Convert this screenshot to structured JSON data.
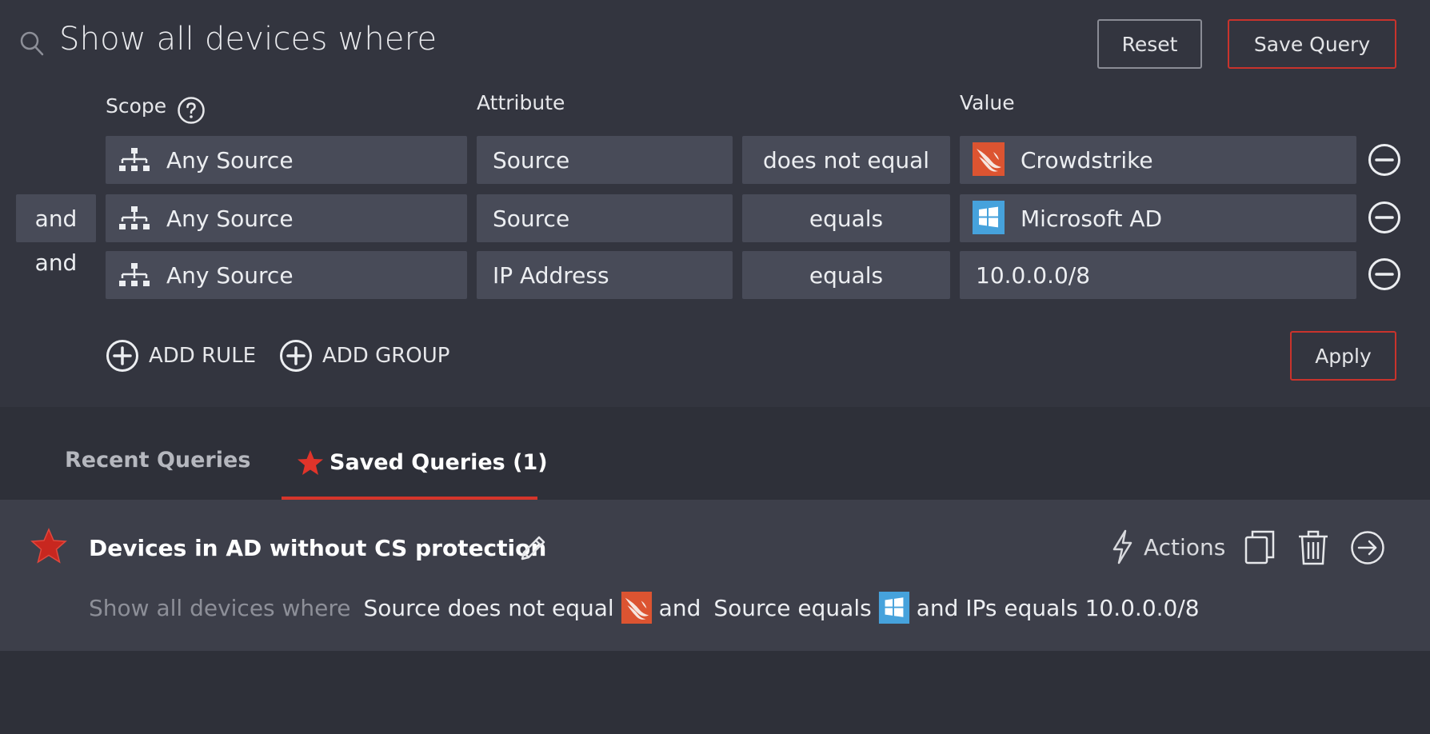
{
  "query": {
    "headline": "Show all devices where",
    "reset_label": "Reset",
    "save_label": "Save Query",
    "apply_label": "Apply",
    "columns": {
      "scope": "Scope",
      "attribute": "Attribute",
      "value": "Value"
    },
    "rules": [
      {
        "conjunction": "",
        "scope": "Any Source",
        "attribute": "Source",
        "operator": "does not equal",
        "value": "Crowdstrike",
        "value_icon": "crowdstrike-logo"
      },
      {
        "conjunction": "and",
        "scope": "Any Source",
        "attribute": "Source",
        "operator": "equals",
        "value": "Microsoft AD",
        "value_icon": "windows-logo"
      },
      {
        "conjunction": "and",
        "scope": "Any Source",
        "attribute": "IP Address",
        "operator": "equals",
        "value": "10.0.0.0/8",
        "value_icon": ""
      }
    ],
    "add_rule_label": "ADD RULE",
    "add_group_label": "ADD GROUP"
  },
  "tabs": [
    {
      "label": "Recent Queries",
      "active": false
    },
    {
      "label": "Saved Queries (1)",
      "active": true
    }
  ],
  "saved": {
    "title": "Devices in AD without CS protection",
    "actions_label": "Actions",
    "summary": {
      "prefix": "Show all devices where",
      "part1": "Source does not equal",
      "and1": "and",
      "part2": "Source equals",
      "part3": "and IPs equals 10.0.0.0/8"
    }
  },
  "colors": {
    "accent": "#d5352b",
    "panel": "#33353f",
    "field": "#484b58",
    "crowdstrike": "#dc5431",
    "windows": "#46a2dc"
  }
}
